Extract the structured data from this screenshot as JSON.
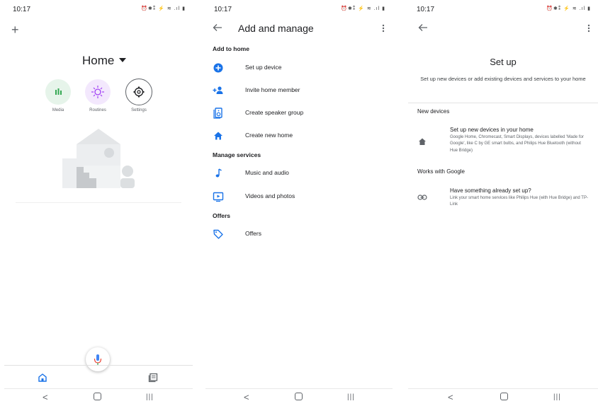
{
  "status": {
    "time": "10:17",
    "icons": "⏰✱⁑ ⚡ ≋ .ıl ▮"
  },
  "screen1": {
    "add_icon": "+",
    "home_title": "Home",
    "shortcuts": [
      {
        "label": "Media"
      },
      {
        "label": "Routines"
      },
      {
        "label": "Settings"
      }
    ]
  },
  "screen2": {
    "title": "Add and manage",
    "sections": {
      "add_to_home": "Add to home",
      "manage_services": "Manage services",
      "offers": "Offers"
    },
    "items": {
      "set_up_device": "Set up device",
      "invite_member": "Invite home member",
      "create_speaker_group": "Create speaker group",
      "create_new_home": "Create new home",
      "music_audio": "Music and audio",
      "videos_photos": "Videos and photos",
      "offers": "Offers"
    }
  },
  "screen3": {
    "title": "Set up",
    "subtitle": "Set up new devices or add existing devices and services to your home",
    "new_devices_header": "New devices",
    "new_devices_title": "Set up new devices in your home",
    "new_devices_desc": "Google Home, Chromecast, Smart Displays, devices labelled 'Made for Google', like C by GE smart bulbs, and Philips Hue Bluetooth (without Hue Bridge)",
    "works_header": "Works with Google",
    "works_title": "Have something already set up?",
    "works_desc": "Link your smart home services like Philips Hue (with Hue Bridge) and TP-Link"
  },
  "colors": {
    "accent_blue": "#1a73e8",
    "media_bg": "#e6f4ea",
    "media_fg": "#34a853",
    "routines_bg": "#f3e8fd",
    "routines_fg": "#a142f4",
    "mic_red": "#ea4335"
  },
  "icons": [
    "add-icon",
    "dropdown-icon",
    "media-icon",
    "routines-icon",
    "settings-icon",
    "mic-icon",
    "home-tab-icon",
    "feed-tab-icon",
    "back-icon",
    "more-icon",
    "add-circle-icon",
    "person-add-icon",
    "speaker-icon",
    "home-icon",
    "music-note-icon",
    "video-icon",
    "tag-icon",
    "link-icon"
  ]
}
